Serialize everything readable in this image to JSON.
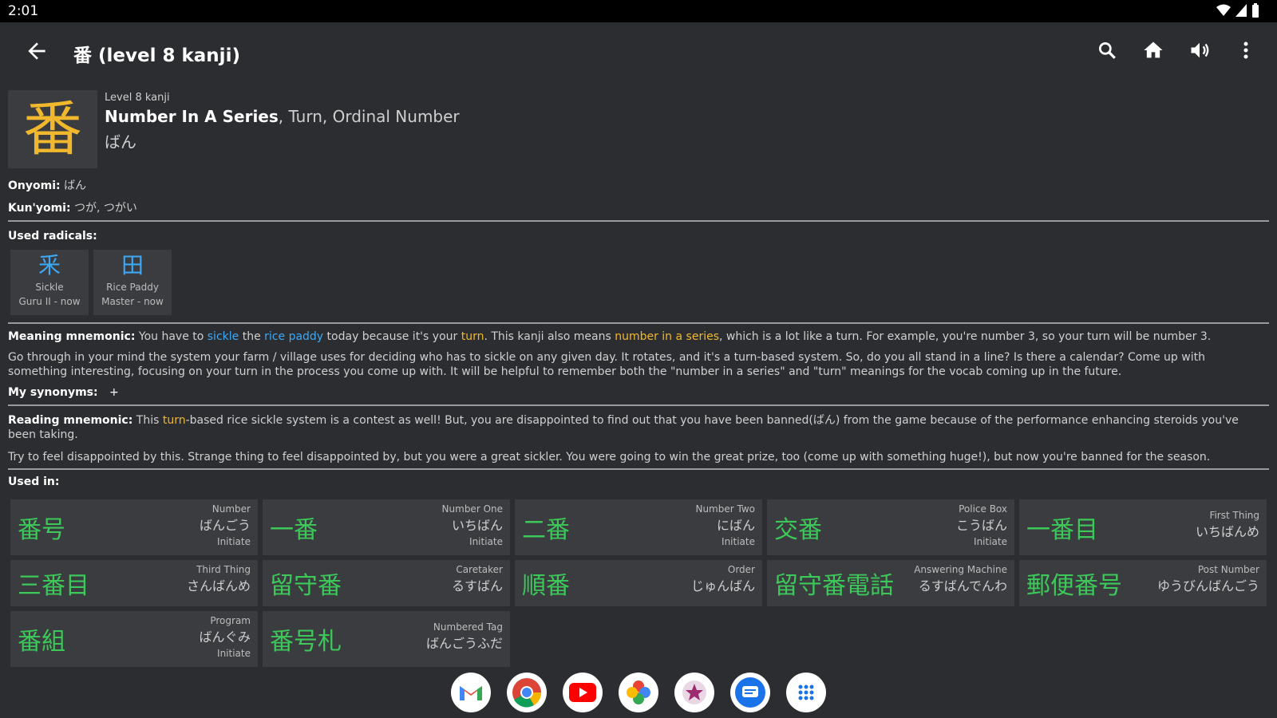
{
  "status": {
    "time": "2:01"
  },
  "appbar": {
    "title": "番 (level 8 kanji)",
    "icons": [
      "back-arrow-icon",
      "search-icon",
      "home-icon",
      "speaker-icon",
      "more-vert-icon"
    ]
  },
  "header": {
    "kanji": "番",
    "level": "Level 8 kanji",
    "meaning_primary": "Number In A Series",
    "meaning_rest": ", Turn, Ordinal Number",
    "reading": "ばん"
  },
  "readings": {
    "onyomi_label": "Onyomi:",
    "onyomi": "ばん",
    "kunyomi_label": "Kun'yomi:",
    "kunyomi": "つが, つがい"
  },
  "radicals": {
    "label": "Used radicals:",
    "items": [
      {
        "glyph": "釆",
        "name": "Sickle",
        "status": "Guru II - now"
      },
      {
        "glyph": "田",
        "name": "Rice Paddy",
        "status": "Master - now"
      }
    ]
  },
  "meaning_mnemonic": {
    "label": "Meaning mnemonic:",
    "t1": " You have to ",
    "k1": "sickle",
    "t2": " the ",
    "k2": "rice paddy",
    "t3": " today because it's your ",
    "k3": "turn",
    "t4": ". This kanji also means ",
    "k4": "number in a series",
    "t5": ", which is a lot like a turn. For example, you're number 3, so your turn will be number 3.",
    "hint": "Go through in your mind the system your farm / village uses for deciding who has to sickle on any given day. It rotates, and it's a turn-based system. So, do you all stand in a line? Is there a calendar? Come up with something interesting, focusing on your turn in the process you come up with. It will be helpful to remember both the \"number in a series\" and \"turn\" meanings for the vocab coming up in the future."
  },
  "synonyms": {
    "label": "My synonyms:",
    "add": "+"
  },
  "reading_mnemonic": {
    "label": "Reading mnemonic:",
    "t1": " This ",
    "k1": "turn",
    "t2": "-based rice sickle system is a contest as well! But, you are disappointed to find out that you have been banned(ばん) from the game because of the performance enhancing steroids you've been taking.",
    "hint": "Try to feel disappointed by this. Strange thing to feel disappointed by, but you were a great sickler. You were going to win the great prize, too (come up with something huge!), but now you're banned for the season."
  },
  "used_in": {
    "label": "Used in:",
    "items": [
      {
        "word": "番号",
        "meaning": "Number",
        "reading": "ばんごう",
        "level": "Initiate"
      },
      {
        "word": "一番",
        "meaning": "Number One",
        "reading": "いちばん",
        "level": "Initiate"
      },
      {
        "word": "二番",
        "meaning": "Number Two",
        "reading": "にばん",
        "level": "Initiate"
      },
      {
        "word": "交番",
        "meaning": "Police Box",
        "reading": "こうばん",
        "level": "Initiate"
      },
      {
        "word": "一番目",
        "meaning": "First Thing",
        "reading": "いちばんめ",
        "level": ""
      },
      {
        "word": "三番目",
        "meaning": "Third Thing",
        "reading": "さんばんめ",
        "level": ""
      },
      {
        "word": "留守番",
        "meaning": "Caretaker",
        "reading": "るすばん",
        "level": ""
      },
      {
        "word": "順番",
        "meaning": "Order",
        "reading": "じゅんばん",
        "level": ""
      },
      {
        "word": "留守番電話",
        "meaning": "Answering Machine",
        "reading": "るすばんでんわ",
        "level": ""
      },
      {
        "word": "郵便番号",
        "meaning": "Post Number",
        "reading": "ゆうびんばんごう",
        "level": ""
      },
      {
        "word": "番組",
        "meaning": "Program",
        "reading": "ばんぐみ",
        "level": "Initiate"
      },
      {
        "word": "番号札",
        "meaning": "Numbered Tag",
        "reading": "ばんごうふだ",
        "level": ""
      }
    ]
  },
  "dock": {
    "apps": [
      "gmail-icon",
      "chrome-icon",
      "youtube-icon",
      "photos-icon",
      "app-icon",
      "messages-icon",
      "app-drawer-icon"
    ]
  }
}
